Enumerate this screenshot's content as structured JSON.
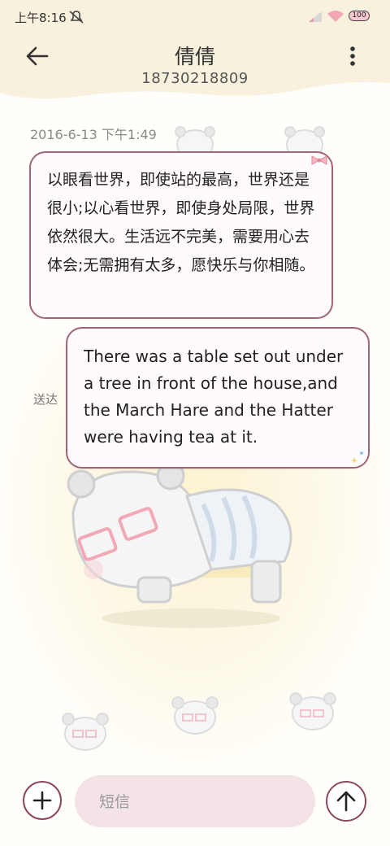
{
  "status_bar": {
    "time": "上午8:16",
    "battery": "100"
  },
  "header": {
    "title": "倩倩",
    "phone": "18730218809"
  },
  "messages": [
    {
      "direction": "incoming",
      "date": "2016-6-13 下午1:49",
      "text": "以眼看世界，即使站的最高，世界还是很小;以心看世界，即使身处局限，世界依然很大。生活远不完美，需要用心去体会;无需拥有太多，愿快乐与你相随。"
    },
    {
      "direction": "outgoing",
      "status": "送达",
      "text": "There was a table set out under a tree in front of the house,and the March Hare and the Hatter were having tea at it."
    }
  ],
  "composer": {
    "placeholder": "短信"
  },
  "colors": {
    "accent": "#8a4a5c",
    "header_bg": "#f8f1dd",
    "input_bg": "#f4e3e6",
    "bubble_border": "#a0677a"
  },
  "icons": {
    "back": "arrow-left-icon",
    "more": "more-vert-icon",
    "add": "plus-icon",
    "send": "arrow-up-icon"
  }
}
